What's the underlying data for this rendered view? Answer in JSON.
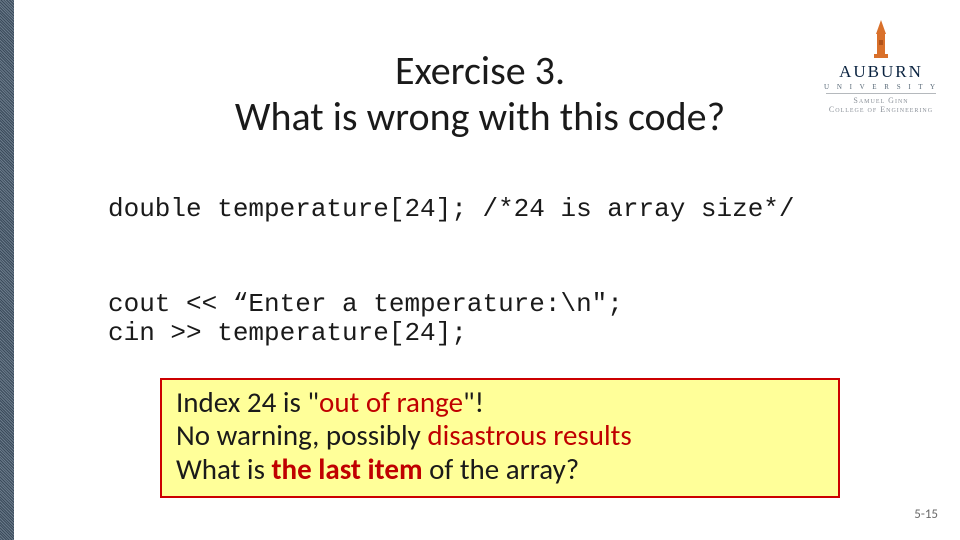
{
  "logo": {
    "wordmark": "AUBURN",
    "sub": "U N I V E R S I T Y",
    "college1": "Samuel Ginn",
    "college2": "College of Engineering"
  },
  "title": {
    "line1": "Exercise 3.",
    "line2": "What is wrong with this code?"
  },
  "code": {
    "line1": "double temperature[24]; /*24 is array size*/",
    "line2": "cout << “Enter a temperature:\\n\";",
    "line3": "cin >> temperature[24];"
  },
  "answer": {
    "l1a": "Index 24 is \"",
    "l1b": "out of range",
    "l1c": "\"!",
    "l2a": "No warning, possibly ",
    "l2b": "disastrous results",
    "l3a": "What is ",
    "l3b": "the last item",
    "l3c": " of the array?"
  },
  "slide_number": "5-15"
}
